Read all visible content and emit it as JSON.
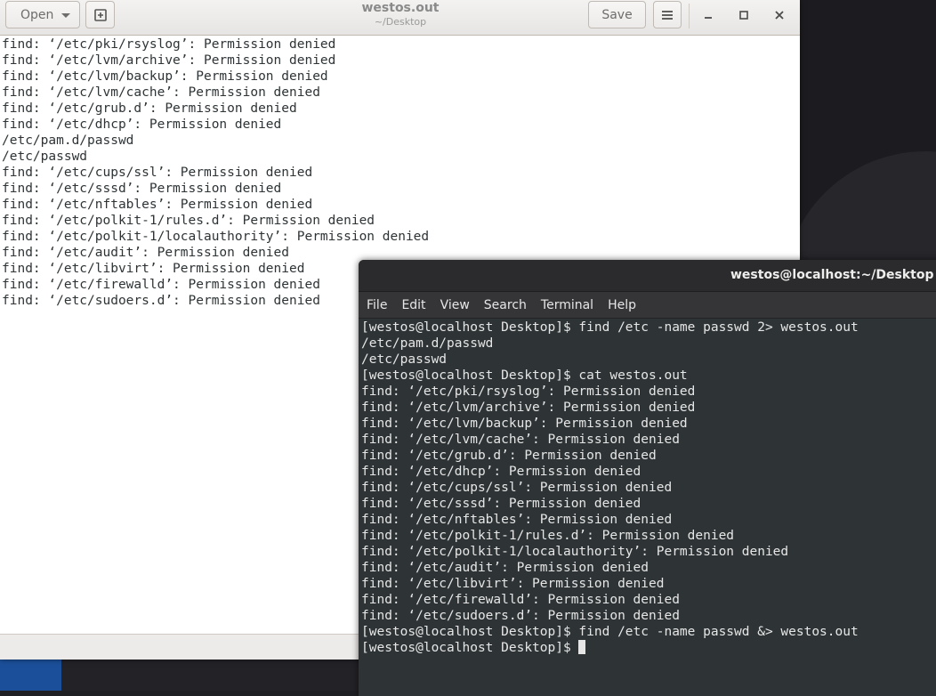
{
  "gedit": {
    "title": "westos.out",
    "subtitle": "~/Desktop",
    "open_label": "Open",
    "save_label": "Save",
    "icons": {
      "new_doc": "new-document-icon",
      "menu": "hamburger-menu-icon",
      "minimize": "minimize-icon",
      "maximize": "maximize-icon",
      "close": "close-icon"
    },
    "lines": [
      "find: ‘/etc/pki/rsyslog’: Permission denied",
      "find: ‘/etc/lvm/archive’: Permission denied",
      "find: ‘/etc/lvm/backup’: Permission denied",
      "find: ‘/etc/lvm/cache’: Permission denied",
      "find: ‘/etc/grub.d’: Permission denied",
      "find: ‘/etc/dhcp’: Permission denied",
      "/etc/pam.d/passwd",
      "/etc/passwd",
      "find: ‘/etc/cups/ssl’: Permission denied",
      "find: ‘/etc/sssd’: Permission denied",
      "find: ‘/etc/nftables’: Permission denied",
      "find: ‘/etc/polkit-1/rules.d’: Permission denied",
      "find: ‘/etc/polkit-1/localauthority’: Permission denied",
      "find: ‘/etc/audit’: Permission denied",
      "find: ‘/etc/libvirt’: Permission denied",
      "find: ‘/etc/firewalld’: Permission denied",
      "find: ‘/etc/sudoers.d’: Permission denied"
    ]
  },
  "terminal": {
    "title": "westos@localhost:~/Desktop",
    "menu": [
      "File",
      "Edit",
      "View",
      "Search",
      "Terminal",
      "Help"
    ],
    "lines": [
      "[westos@localhost Desktop]$ find /etc -name passwd 2> westos.out",
      "/etc/pam.d/passwd",
      "/etc/passwd",
      "[westos@localhost Desktop]$ cat westos.out",
      "find: ‘/etc/pki/rsyslog’: Permission denied",
      "find: ‘/etc/lvm/archive’: Permission denied",
      "find: ‘/etc/lvm/backup’: Permission denied",
      "find: ‘/etc/lvm/cache’: Permission denied",
      "find: ‘/etc/grub.d’: Permission denied",
      "find: ‘/etc/dhcp’: Permission denied",
      "find: ‘/etc/cups/ssl’: Permission denied",
      "find: ‘/etc/sssd’: Permission denied",
      "find: ‘/etc/nftables’: Permission denied",
      "find: ‘/etc/polkit-1/rules.d’: Permission denied",
      "find: ‘/etc/polkit-1/localauthority’: Permission denied",
      "find: ‘/etc/audit’: Permission denied",
      "find: ‘/etc/libvirt’: Permission denied",
      "find: ‘/etc/firewalld’: Permission denied",
      "find: ‘/etc/sudoers.d’: Permission denied",
      "[westos@localhost Desktop]$ find /etc -name passwd &> westos.out"
    ],
    "prompt": "[westos@localhost Desktop]$ "
  },
  "colors": {
    "terminal_bg": "#2e3436",
    "terminal_fg": "#e6e6e6",
    "dock_app": "#1b4f9a"
  }
}
